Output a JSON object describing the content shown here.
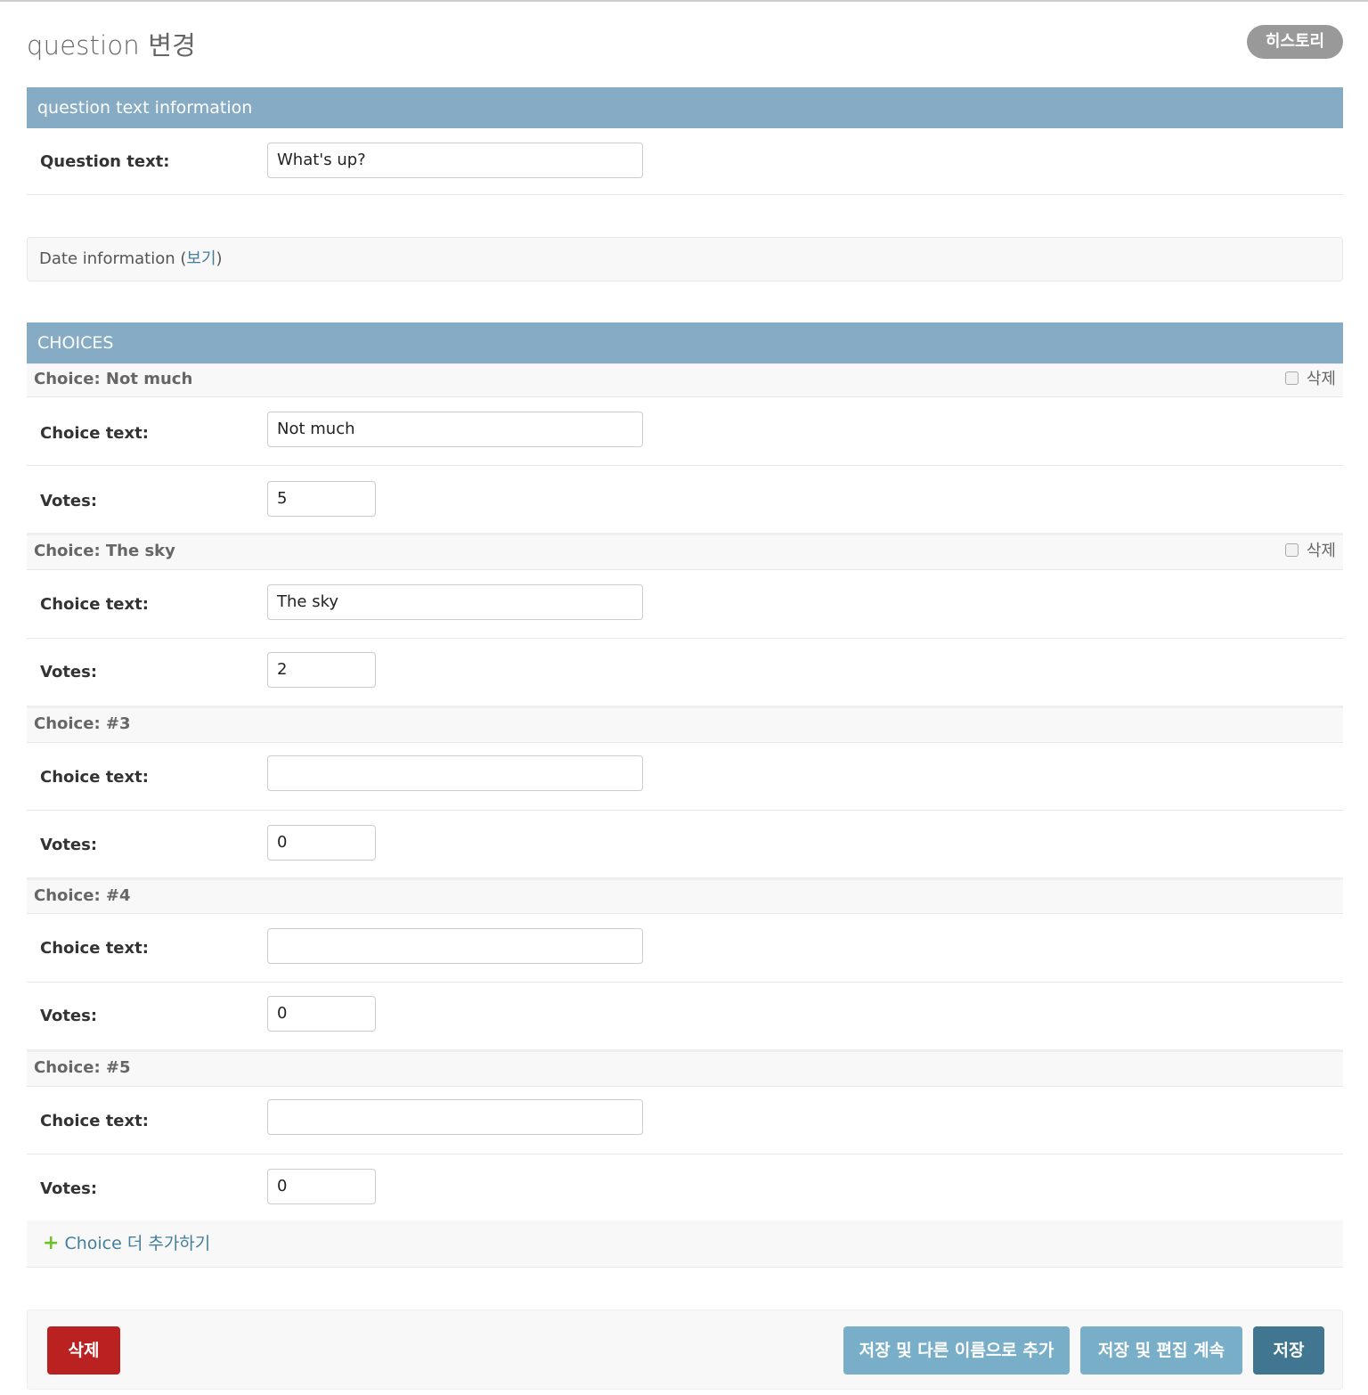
{
  "header": {
    "title": "question 변경",
    "history_label": "히스토리"
  },
  "question_section": {
    "heading": "question text information",
    "question_text_label": "Question text:",
    "question_text_value": "What's up?"
  },
  "date_section": {
    "heading": "Date information",
    "toggle_open": "(",
    "toggle_label": "보기",
    "toggle_close": ")"
  },
  "choices": {
    "heading": "CHOICES",
    "delete_label": "삭제",
    "choice_text_label": "Choice text:",
    "votes_label": "Votes:",
    "items": [
      {
        "title": "Choice: Not much",
        "choice_text": "Not much",
        "votes": "5"
      },
      {
        "title": "Choice: The sky",
        "choice_text": "The sky",
        "votes": "2"
      },
      {
        "title": "Choice: #3",
        "choice_text": "",
        "votes": "0"
      },
      {
        "title": "Choice: #4",
        "choice_text": "",
        "votes": "0"
      },
      {
        "title": "Choice: #5",
        "choice_text": "",
        "votes": "0"
      }
    ],
    "add_another_label": "Choice 더 추가하기"
  },
  "submit_row": {
    "delete_label": "삭제",
    "save_as_new_label": "저장 및 다른 이름으로 추가",
    "save_continue_label": "저장 및 편집 계속",
    "save_label": "저장"
  }
}
